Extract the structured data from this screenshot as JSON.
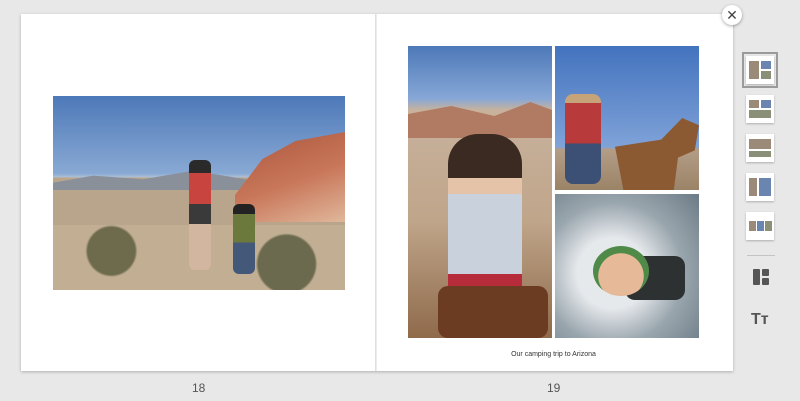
{
  "book": {
    "caption": "Our camping trip to Arizona",
    "left_page_number": "18",
    "right_page_number": "19"
  },
  "controls": {
    "close_glyph": "✕",
    "text_tool_glyph": "Tт"
  },
  "icons": {
    "close": "close-icon",
    "layout": "layout-icon",
    "text": "text-size-icon"
  },
  "thumbnails": [
    {
      "label": "Page layout 1",
      "active": true
    },
    {
      "label": "Page layout 2",
      "active": false
    },
    {
      "label": "Page layout 3",
      "active": false
    },
    {
      "label": "Page layout 4",
      "active": false
    },
    {
      "label": "Page layout 5",
      "active": false
    }
  ]
}
